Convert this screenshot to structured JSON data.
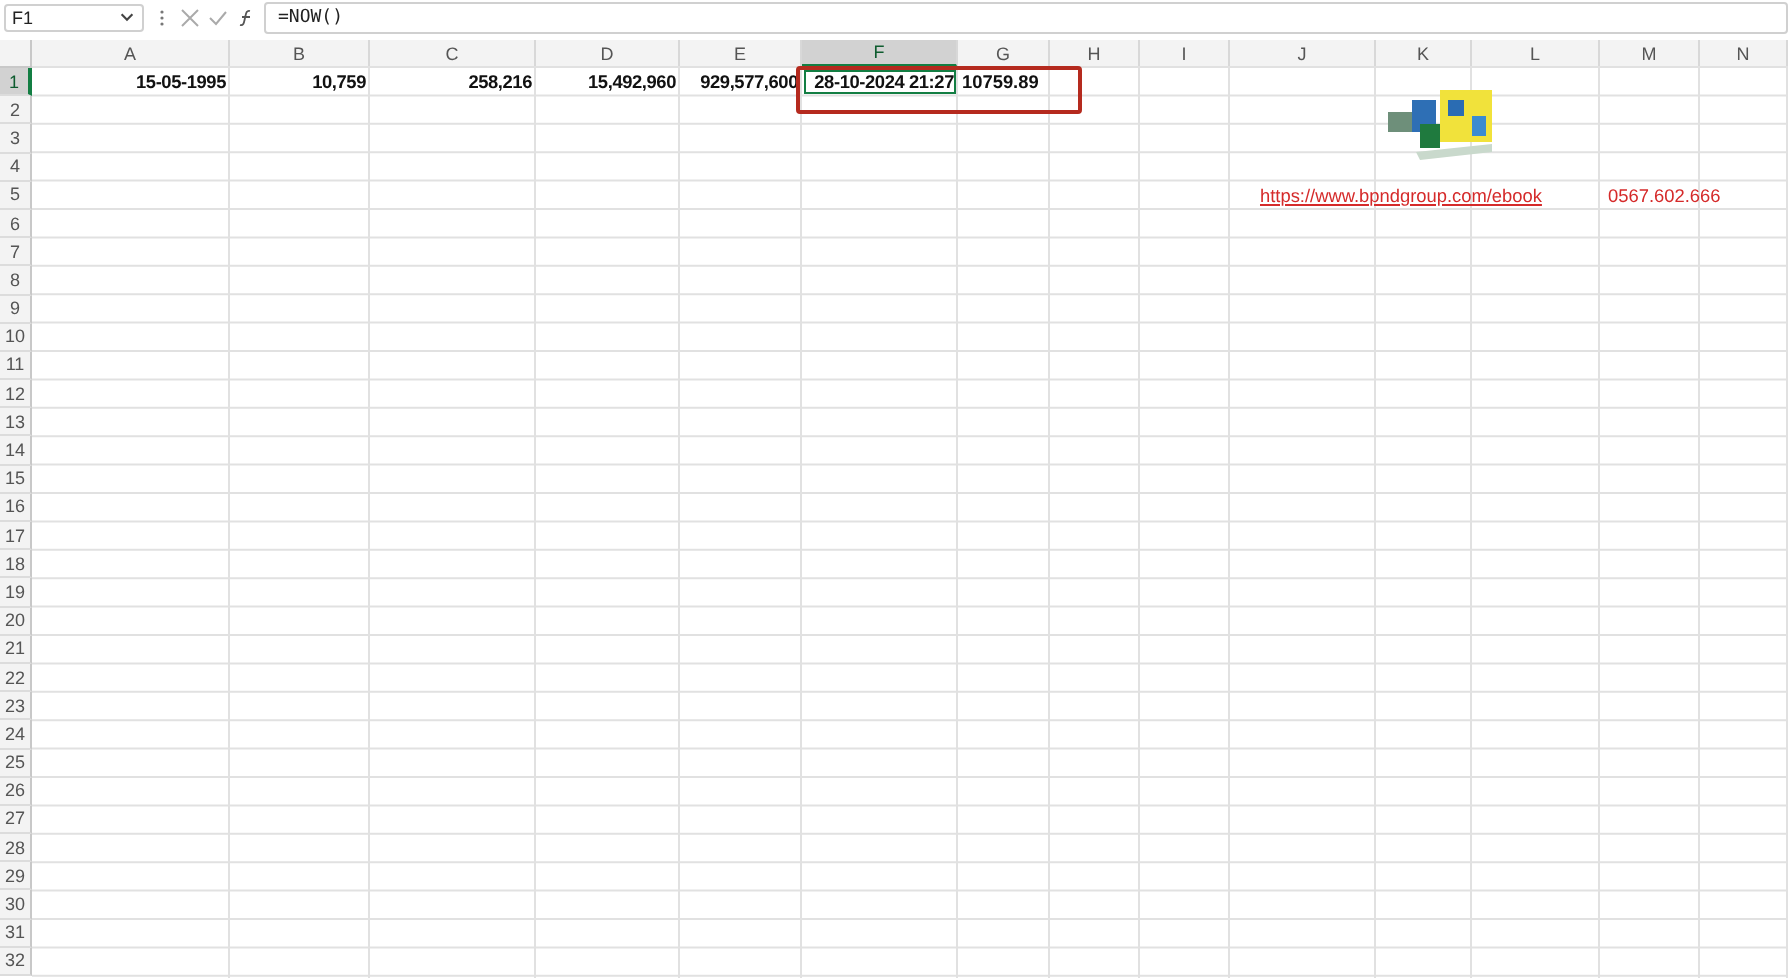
{
  "formula_bar": {
    "name_box": "F1",
    "formula": "=NOW()"
  },
  "columns": [
    {
      "label": "A",
      "selected": false
    },
    {
      "label": "B",
      "selected": false
    },
    {
      "label": "C",
      "selected": false
    },
    {
      "label": "D",
      "selected": false
    },
    {
      "label": "E",
      "selected": false
    },
    {
      "label": "F",
      "selected": true
    },
    {
      "label": "G",
      "selected": false
    },
    {
      "label": "H",
      "selected": false
    },
    {
      "label": "I",
      "selected": false
    },
    {
      "label": "J",
      "selected": false
    },
    {
      "label": "K",
      "selected": false
    },
    {
      "label": "L",
      "selected": false
    },
    {
      "label": "M",
      "selected": false
    },
    {
      "label": "N",
      "selected": false
    }
  ],
  "rows": [
    {
      "number": "1",
      "selected": true,
      "cells": [
        {
          "text": "15-05-1995",
          "kind": "number",
          "selected": false
        },
        {
          "text": "10,759",
          "kind": "number",
          "selected": false
        },
        {
          "text": "258,216",
          "kind": "number",
          "selected": false
        },
        {
          "text": "15,492,960",
          "kind": "number",
          "selected": false
        },
        {
          "text": "929,577,600",
          "kind": "number",
          "selected": false
        },
        {
          "text": "28-10-2024 21:27",
          "kind": "number",
          "selected": true
        },
        {
          "text": "10759.89",
          "kind": "text",
          "selected": false
        }
      ]
    },
    {
      "number": "2",
      "selected": false
    },
    {
      "number": "3",
      "selected": false
    },
    {
      "number": "4",
      "selected": false
    },
    {
      "number": "5",
      "selected": false
    },
    {
      "number": "6",
      "selected": false
    },
    {
      "number": "7",
      "selected": false
    },
    {
      "number": "8",
      "selected": false
    },
    {
      "number": "9",
      "selected": false
    },
    {
      "number": "10",
      "selected": false
    },
    {
      "number": "11",
      "selected": false
    },
    {
      "number": "12",
      "selected": false
    },
    {
      "number": "13",
      "selected": false
    },
    {
      "number": "14",
      "selected": false
    },
    {
      "number": "15",
      "selected": false
    },
    {
      "number": "16",
      "selected": false
    },
    {
      "number": "17",
      "selected": false
    },
    {
      "number": "18",
      "selected": false
    },
    {
      "number": "19",
      "selected": false
    },
    {
      "number": "20",
      "selected": false
    },
    {
      "number": "21",
      "selected": false
    },
    {
      "number": "22",
      "selected": false
    },
    {
      "number": "23",
      "selected": false
    },
    {
      "number": "24",
      "selected": false
    },
    {
      "number": "25",
      "selected": false
    },
    {
      "number": "26",
      "selected": false
    },
    {
      "number": "27",
      "selected": false
    },
    {
      "number": "28",
      "selected": false
    },
    {
      "number": "29",
      "selected": false
    },
    {
      "number": "30",
      "selected": false
    },
    {
      "number": "31",
      "selected": false
    },
    {
      "number": "32",
      "selected": false
    }
  ],
  "contact": {
    "link": "https://www.bpndgroup.com/ebook",
    "phone": "0567.602.666"
  }
}
